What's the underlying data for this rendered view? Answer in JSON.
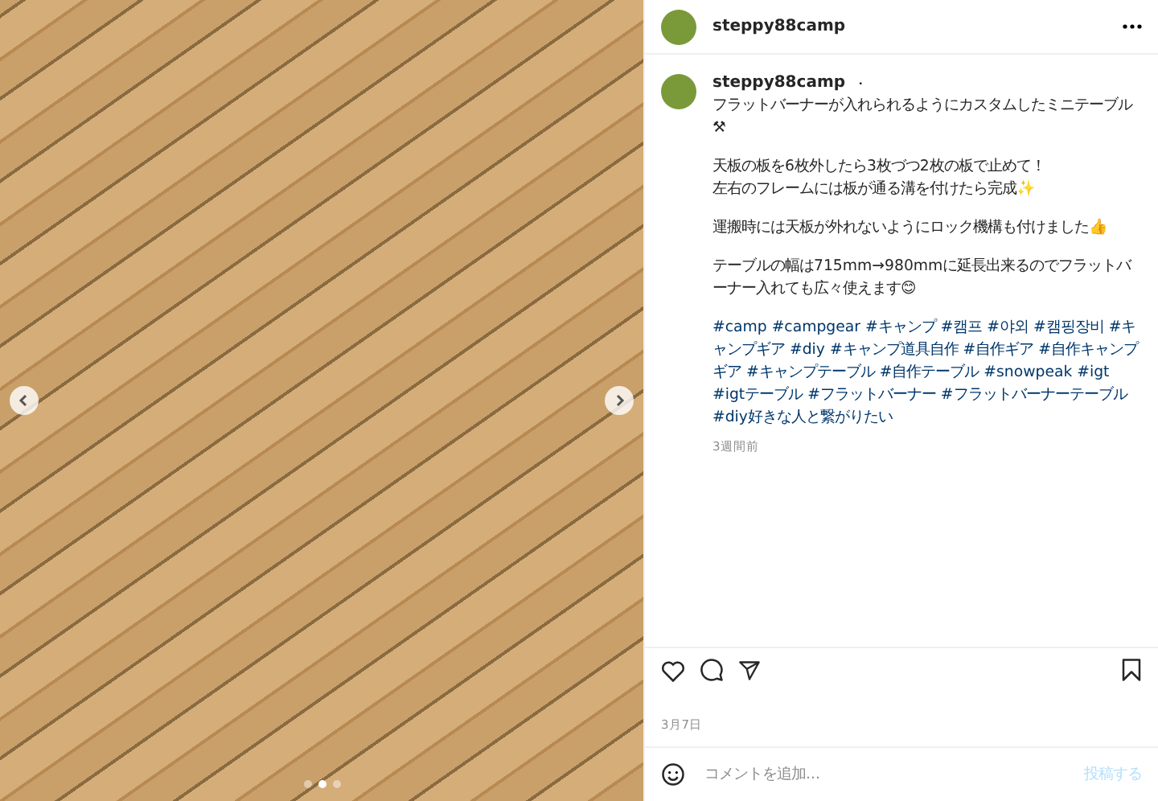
{
  "photo": {
    "dots": [
      {
        "selected": false
      },
      {
        "selected": true
      },
      {
        "selected": false
      }
    ]
  },
  "header": {
    "username": "steppy88camp"
  },
  "caption": {
    "username": "steppy88camp",
    "separator": "・",
    "paragraphs": [
      [
        "フラットバーナーが入れられるようにカスタムしたミニテーブル⚒"
      ],
      [
        "天板の板を6枚外したら3枚づつ2枚の板で止めて！",
        "左右のフレームには板が通る溝を付けたら完成✨"
      ],
      [
        "運搬時には天板が外れないようにロック機構も付けました👍"
      ],
      [
        "テーブルの幅は715mm→980mmに延長出来るのでフラットバーナー入れても広々使えます😊"
      ]
    ],
    "hashtags": [
      "#camp",
      "#campgear",
      "#キャンプ",
      "#캠프",
      "#야외",
      "#캠핑장비",
      "#キャンプギア",
      "#diy",
      "#キャンプ道具自作",
      "#自作ギア",
      "#自作キャンプギア",
      "#キャンプテーブル",
      "#自作テーブル",
      "#snowpeak",
      "#igt",
      "#igtテーブル",
      "#フラットバーナー",
      "#フラットバーナーテーブル",
      "#diy好きな人と繋がりたい"
    ],
    "time": "3週間前"
  },
  "actions": {
    "liked": false,
    "saved": false
  },
  "date": "3月7日",
  "comment": {
    "placeholder": "コメントを追加...",
    "post_button": "投稿する"
  }
}
